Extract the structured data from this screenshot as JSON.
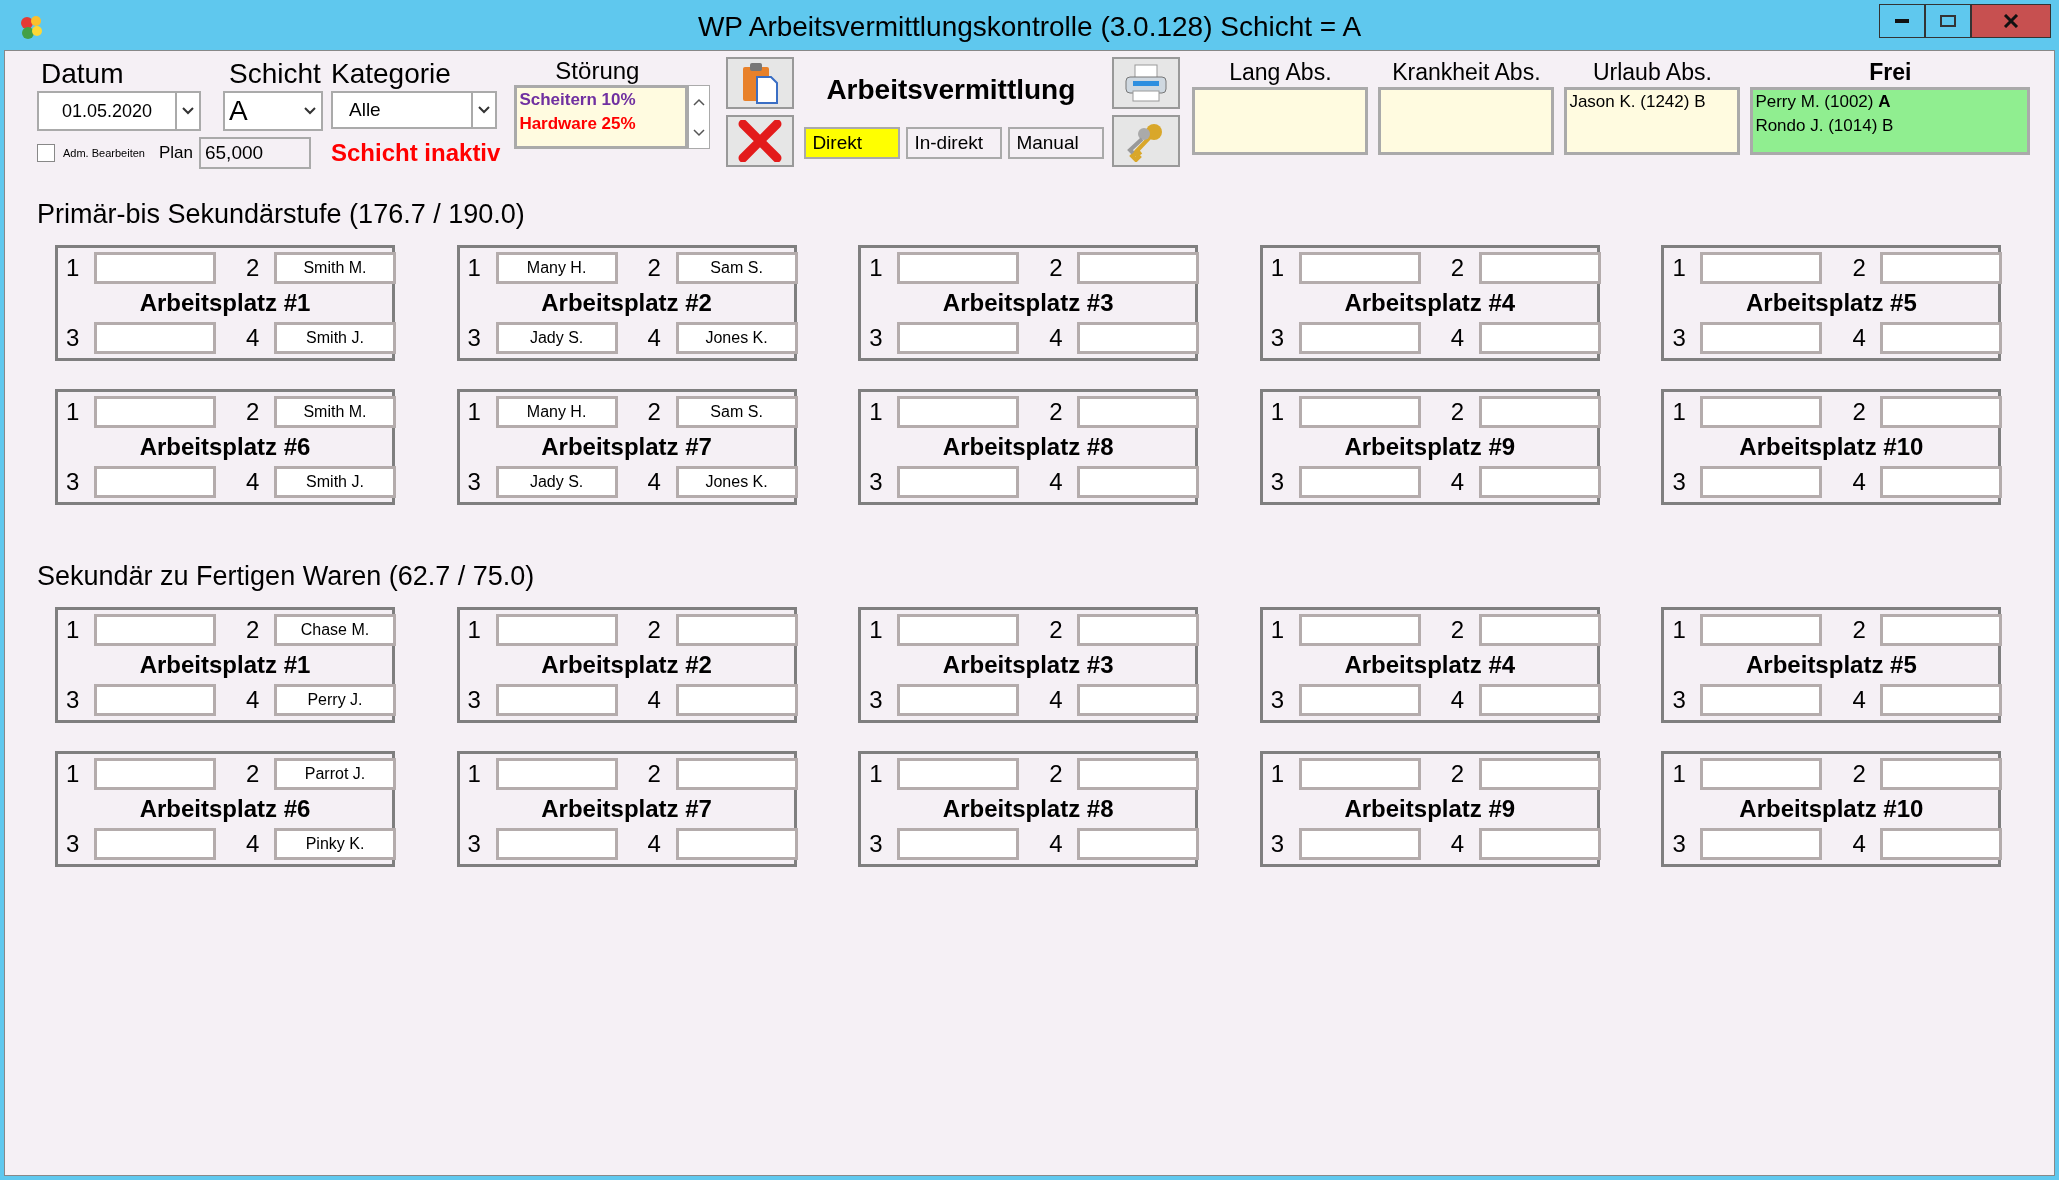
{
  "window": {
    "title": "WP Arbeitsvermittlungskontrolle (3.0.128) Schicht = A"
  },
  "filters": {
    "datum": {
      "label": "Datum",
      "value": "01.05.2020"
    },
    "schicht": {
      "label": "Schicht",
      "value": "A"
    },
    "kategorie": {
      "label": "Kategorie",
      "value": "Alle"
    },
    "adm_bearbeiten": {
      "label": "Adm. Bearbeiten",
      "checked": false
    },
    "plan": {
      "label": "Plan",
      "value": "65,000"
    },
    "status": "Schicht inaktiv"
  },
  "stoerung": {
    "label": "Störung",
    "items": [
      {
        "text": "Scheitern 10%",
        "color": "#7030a0"
      },
      {
        "text": "Hardware 25%",
        "color": "#ff0000"
      }
    ]
  },
  "vermittlung": {
    "title": "Arbeitsvermittlung",
    "modes": [
      {
        "label": "Direkt",
        "selected": true
      },
      {
        "label": "In-direkt",
        "selected": false
      },
      {
        "label": "Manual",
        "selected": false
      }
    ]
  },
  "absences": [
    {
      "label": "Lang Abs.",
      "kind": "plain"
    },
    {
      "label": "Krankheit Abs.",
      "kind": "plain"
    },
    {
      "label": "Urlaub Abs.",
      "kind": "plain",
      "entries": [
        "Jason K. (1242) B"
      ]
    },
    {
      "label": "Frei",
      "kind": "free",
      "entries": [
        "Perry M. (1002) **A**",
        "Rondo J. (1014) B"
      ]
    }
  ],
  "sections": [
    {
      "title": "Primär-bis Sekundärstufe (176.7 / 190.0)",
      "workstations": [
        {
          "name": "Arbeitsplatz #1",
          "slots": [
            {
              "number": "1"
            },
            {
              "number": "2",
              "name": "Smith M."
            },
            {
              "number": "3"
            },
            {
              "number": "4",
              "name": "Smith J."
            }
          ]
        },
        {
          "name": "Arbeitsplatz #2",
          "slots": [
            {
              "number": "1",
              "name": "Many H."
            },
            {
              "number": "2",
              "name": "Sam S."
            },
            {
              "number": "3",
              "name": "Jady S."
            },
            {
              "number": "4",
              "name": "Jones K."
            }
          ]
        },
        {
          "name": "Arbeitsplatz #3",
          "slots": [
            {
              "number": "1"
            },
            {
              "number": "2"
            },
            {
              "number": "3"
            },
            {
              "number": "4"
            }
          ]
        },
        {
          "name": "Arbeitsplatz #4",
          "slots": [
            {
              "number": "1"
            },
            {
              "number": "2"
            },
            {
              "number": "3"
            },
            {
              "number": "4"
            }
          ]
        },
        {
          "name": "Arbeitsplatz #5",
          "slots": [
            {
              "number": "1"
            },
            {
              "number": "2"
            },
            {
              "number": "3"
            },
            {
              "number": "4"
            }
          ]
        },
        {
          "name": "Arbeitsplatz #6",
          "slots": [
            {
              "number": "1"
            },
            {
              "number": "2",
              "name": "Smith M."
            },
            {
              "number": "3"
            },
            {
              "number": "4",
              "name": "Smith J."
            }
          ]
        },
        {
          "name": "Arbeitsplatz #7",
          "slots": [
            {
              "number": "1",
              "name": "Many H."
            },
            {
              "number": "2",
              "name": "Sam S."
            },
            {
              "number": "3",
              "name": "Jady S."
            },
            {
              "number": "4",
              "name": "Jones K."
            }
          ]
        },
        {
          "name": "Arbeitsplatz #8",
          "slots": [
            {
              "number": "1"
            },
            {
              "number": "2"
            },
            {
              "number": "3"
            },
            {
              "number": "4"
            }
          ]
        },
        {
          "name": "Arbeitsplatz #9",
          "slots": [
            {
              "number": "1"
            },
            {
              "number": "2"
            },
            {
              "number": "3"
            },
            {
              "number": "4"
            }
          ]
        },
        {
          "name": "Arbeitsplatz #10",
          "slots": [
            {
              "number": "1"
            },
            {
              "number": "2"
            },
            {
              "number": "3"
            },
            {
              "number": "4"
            }
          ]
        }
      ]
    },
    {
      "title": "Sekundär zu Fertigen Waren (62.7 / 75.0)",
      "workstations": [
        {
          "name": "Arbeitsplatz #1",
          "slots": [
            {
              "number": "1"
            },
            {
              "number": "2",
              "name": "Chase M."
            },
            {
              "number": "3"
            },
            {
              "number": "4",
              "name": "Perry J."
            }
          ]
        },
        {
          "name": "Arbeitsplatz #2",
          "slots": [
            {
              "number": "1"
            },
            {
              "number": "2"
            },
            {
              "number": "3"
            },
            {
              "number": "4"
            }
          ]
        },
        {
          "name": "Arbeitsplatz #3",
          "slots": [
            {
              "number": "1"
            },
            {
              "number": "2"
            },
            {
              "number": "3"
            },
            {
              "number": "4"
            }
          ]
        },
        {
          "name": "Arbeitsplatz #4",
          "slots": [
            {
              "number": "1"
            },
            {
              "number": "2"
            },
            {
              "number": "3"
            },
            {
              "number": "4"
            }
          ]
        },
        {
          "name": "Arbeitsplatz #5",
          "slots": [
            {
              "number": "1"
            },
            {
              "number": "2"
            },
            {
              "number": "3"
            },
            {
              "number": "4"
            }
          ]
        },
        {
          "name": "Arbeitsplatz #6",
          "slots": [
            {
              "number": "1"
            },
            {
              "number": "2",
              "name": "Parrot J."
            },
            {
              "number": "3"
            },
            {
              "number": "4",
              "name": "Pinky K."
            }
          ]
        },
        {
          "name": "Arbeitsplatz #7",
          "slots": [
            {
              "number": "1"
            },
            {
              "number": "2"
            },
            {
              "number": "3"
            },
            {
              "number": "4"
            }
          ]
        },
        {
          "name": "Arbeitsplatz #8",
          "slots": [
            {
              "number": "1"
            },
            {
              "number": "2"
            },
            {
              "number": "3"
            },
            {
              "number": "4"
            }
          ]
        },
        {
          "name": "Arbeitsplatz #9",
          "slots": [
            {
              "number": "1"
            },
            {
              "number": "2"
            },
            {
              "number": "3"
            },
            {
              "number": "4"
            }
          ]
        },
        {
          "name": "Arbeitsplatz #10",
          "slots": [
            {
              "number": "1"
            },
            {
              "number": "2"
            },
            {
              "number": "3"
            },
            {
              "number": "4"
            }
          ]
        }
      ]
    }
  ]
}
